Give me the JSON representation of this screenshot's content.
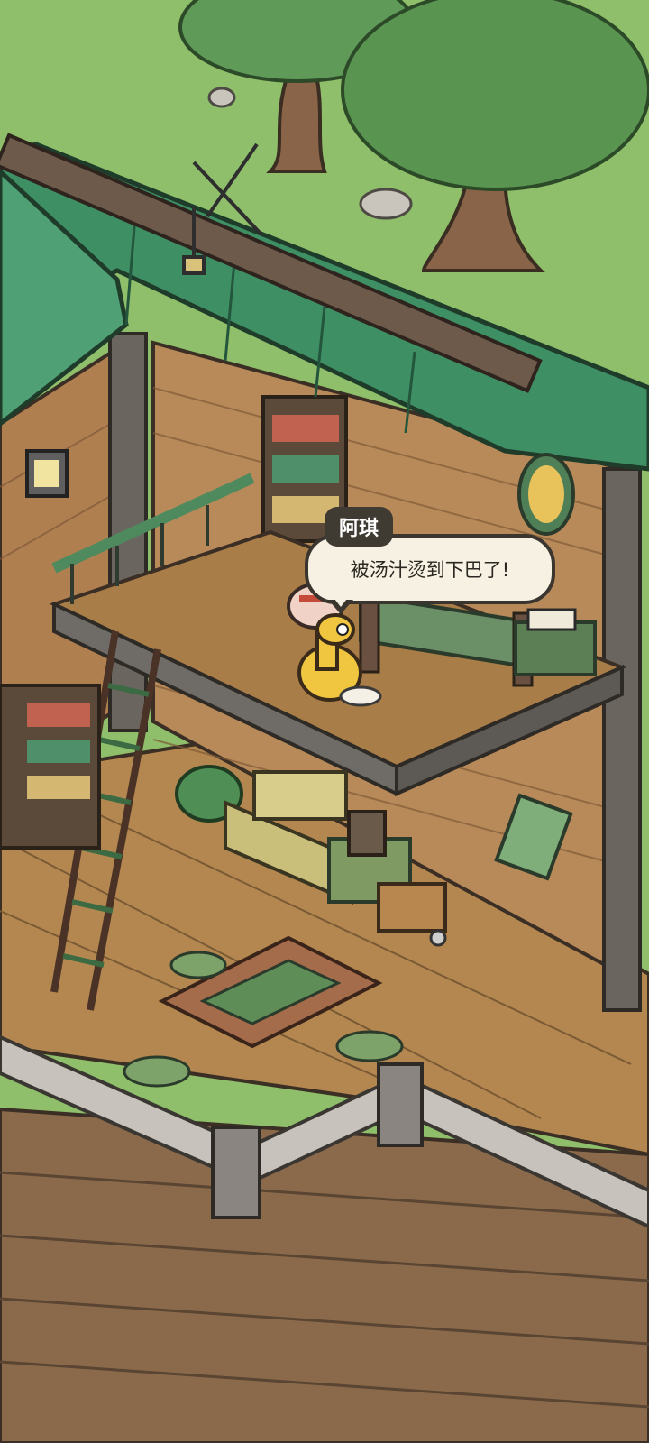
{
  "dialogue": {
    "speaker": "阿琪",
    "text": "被汤汁烫到下巴了!"
  },
  "scene": {
    "setting": "treehouse-cabin",
    "colors": {
      "grass": "#8fbf6a",
      "roof": "#3f8f65",
      "brick": "#b98a59",
      "floor": "#b3874f",
      "deck": "#8b6a4b",
      "trim": "#6f6c68"
    }
  }
}
